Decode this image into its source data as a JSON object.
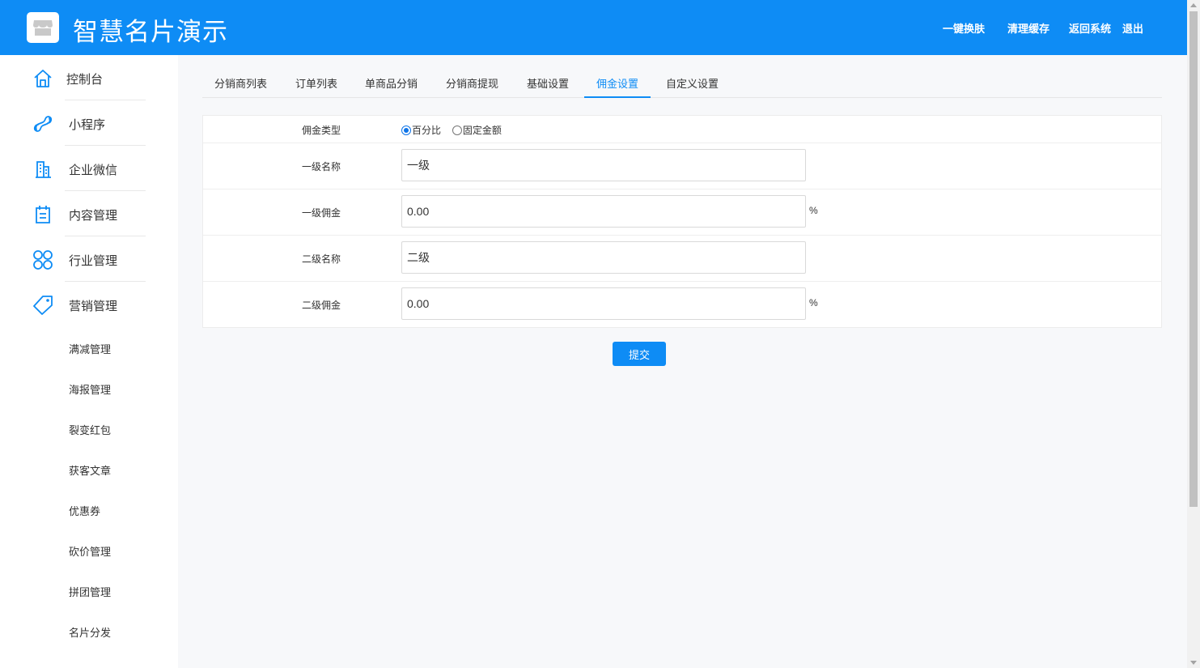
{
  "header": {
    "title": "智慧名片演示",
    "links": [
      {
        "label": "一键换肤"
      },
      {
        "label": "清理缓存"
      },
      {
        "label": "返回系统"
      },
      {
        "label": "退出"
      }
    ],
    "bg_color": "#0e8cf5"
  },
  "sidebar": {
    "main_items": [
      {
        "label": "控制台",
        "icon": "home-icon"
      },
      {
        "label": "小程序",
        "icon": "miniprogram-icon"
      },
      {
        "label": "企业微信",
        "icon": "building-icon"
      },
      {
        "label": "内容管理",
        "icon": "clipboard-icon"
      },
      {
        "label": "行业管理",
        "icon": "clover-icon"
      },
      {
        "label": "营销管理",
        "icon": "tag-icon"
      }
    ],
    "sub_items": [
      {
        "label": "满减管理"
      },
      {
        "label": "海报管理"
      },
      {
        "label": "裂变红包"
      },
      {
        "label": "获客文章"
      },
      {
        "label": "优惠券"
      },
      {
        "label": "砍价管理"
      },
      {
        "label": "拼团管理"
      },
      {
        "label": "名片分发"
      }
    ]
  },
  "tabs": [
    {
      "label": "分销商列表",
      "active": false
    },
    {
      "label": "订单列表",
      "active": false
    },
    {
      "label": "单商品分销",
      "active": false
    },
    {
      "label": "分销商提现",
      "active": false
    },
    {
      "label": "基础设置",
      "active": false
    },
    {
      "label": "佣金设置",
      "active": true
    },
    {
      "label": "自定义设置",
      "active": false
    }
  ],
  "form": {
    "commission_type": {
      "label": "佣金类型",
      "options": [
        {
          "label": "百分比",
          "checked": true
        },
        {
          "label": "固定金额",
          "checked": false
        }
      ]
    },
    "level1_name": {
      "label": "一级名称",
      "value": "一级"
    },
    "level1_commission": {
      "label": "一级佣金",
      "value": "0.00",
      "unit": "%"
    },
    "level2_name": {
      "label": "二级名称",
      "value": "二级"
    },
    "level2_commission": {
      "label": "二级佣金",
      "value": "0.00",
      "unit": "%"
    }
  },
  "submit_label": "提交",
  "accent_color": "#0e8cf5"
}
